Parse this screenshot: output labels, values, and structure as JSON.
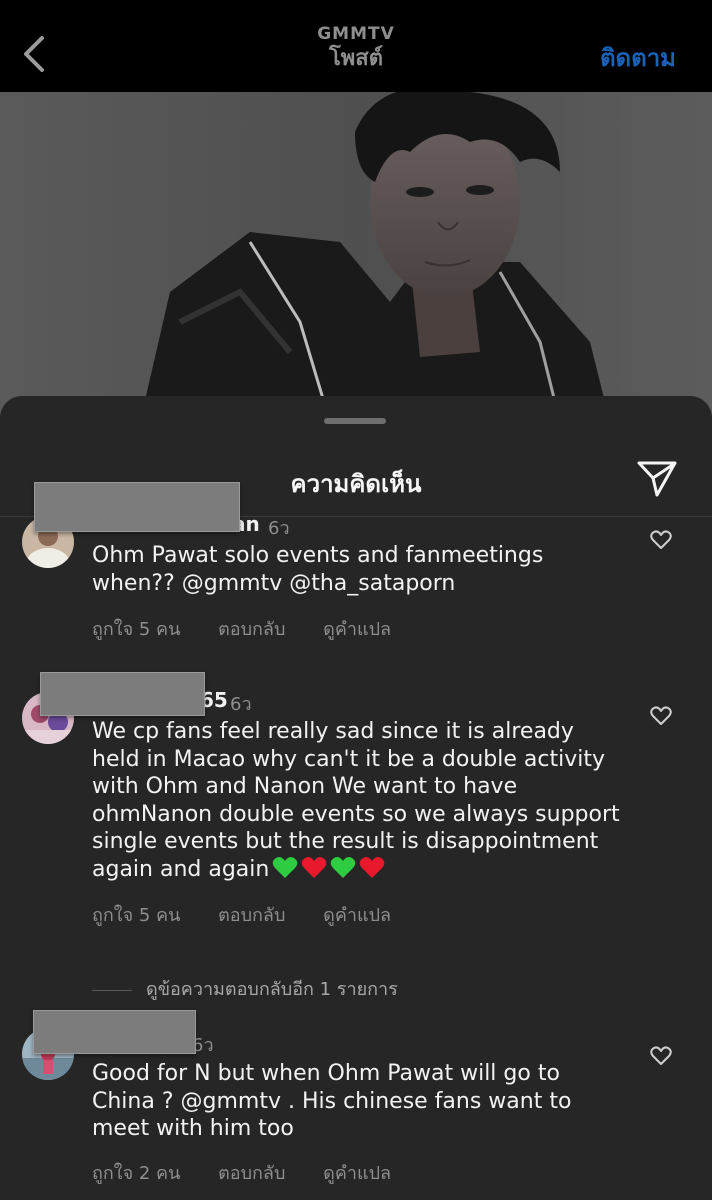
{
  "header": {
    "account": "GMMTV",
    "title": "โพสต์",
    "follow_label": "ติดตาม"
  },
  "sheet": {
    "title": "ความคิดเห็น"
  },
  "comments": [
    {
      "username_suffix": "an",
      "time": "6ว",
      "text": "Ohm Pawat solo events and fanmeetings when?? @gmmtv @tha_sataporn",
      "likes": "ถูกใจ 5 คน",
      "reply": "ตอบกลับ",
      "translate": "ดูคำแปล"
    },
    {
      "username_suffix": "65",
      "time": "6ว",
      "text": "We cp fans feel really sad since it is already held in Macao why can't it be a double activity with Ohm and Nanon We want to have ohmNanon double events so we always support single events but the result is disappointment again and again",
      "emojis": [
        "green-heart",
        "red-heart",
        "green-heart",
        "red-heart"
      ],
      "likes": "ถูกใจ 5 คน",
      "reply": "ตอบกลับ",
      "translate": "ดูคำแปล"
    },
    {
      "username_suffix": "",
      "time": "6ว",
      "text": "Good for N but when Ohm Pawat will go to China ? @gmmtv . His chinese fans want to meet with him too",
      "likes": "ถูกใจ 2 คน",
      "reply": "ตอบกลับ",
      "translate": "ดูคำแปล"
    }
  ],
  "view_replies": "ดูข้อความตอบกลับอีก 1 รายการ",
  "colors": {
    "accent": "#1a61b8",
    "sheet_bg": "#262626",
    "muted": "#8e8e8e",
    "green_heart": "#2ecc40",
    "red_heart": "#e8192c"
  }
}
